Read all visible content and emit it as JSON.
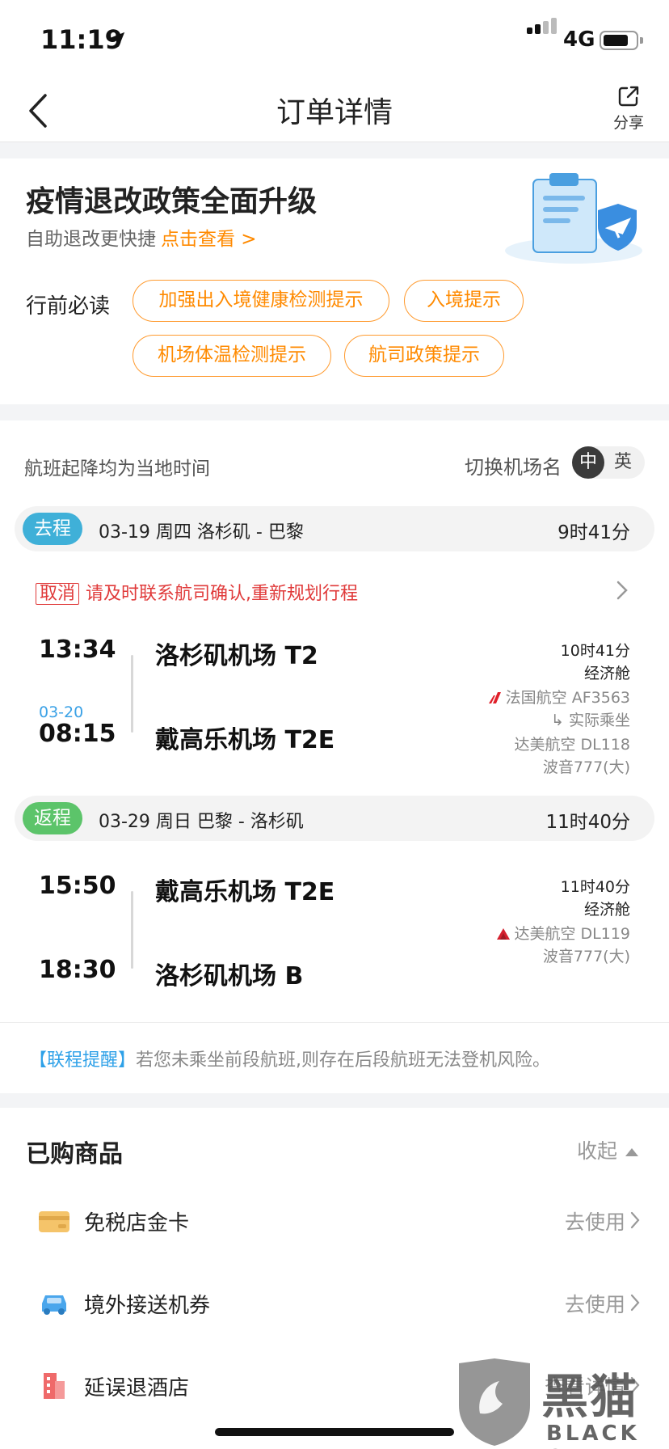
{
  "status_bar": {
    "time": "11:19",
    "network": "4G"
  },
  "nav": {
    "title": "订单详情",
    "share_label": "分享"
  },
  "policy": {
    "title": "疫情退改政策全面升级",
    "subtitle": "自助退改更快捷",
    "link": "点击查看 >",
    "must_read_label": "行前必读",
    "tags": [
      "加强出入境健康检测提示",
      "入境提示",
      "机场体温检测提示",
      "航司政策提示"
    ]
  },
  "flights": {
    "tz_note": "航班起降均为当地时间",
    "switch_label": "切换机场名",
    "lang_zh": "中",
    "lang_en": "英",
    "outbound": {
      "tag": "去程",
      "info": "03-19  周四  洛杉矶 - 巴黎",
      "duration": "9时41分",
      "cancel_tag": "取消",
      "cancel_text": "请及时联系航司确认,重新规划行程",
      "dep_time": "13:34",
      "dep_airport": "洛杉矶机场 T2",
      "arr_date": "03-20",
      "arr_time": "08:15",
      "arr_airport": "戴高乐机场 T2E",
      "flight_duration": "10时41分",
      "cabin": "经济舱",
      "airline": "法国航空 AF3563",
      "actual_label": "↳ 实际乘坐",
      "operating": "达美航空 DL118",
      "aircraft": "波音777(大)"
    },
    "return": {
      "tag": "返程",
      "info": "03-29  周日  巴黎 - 洛杉矶",
      "duration": "11时40分",
      "dep_time": "15:50",
      "dep_airport": "戴高乐机场 T2E",
      "arr_time": "18:30",
      "arr_airport": "洛杉矶机场 B",
      "flight_duration": "11时40分",
      "cabin": "经济舱",
      "airline": "达美航空 DL119",
      "aircraft": "波音777(大)"
    },
    "reminder_tag": "【联程提醒】",
    "reminder_text": "若您未乘坐前段航班,则存在后段航班无法登机风险。"
  },
  "goods": {
    "title": "已购商品",
    "fold_label": "收起",
    "items": [
      {
        "name": "免税店金卡",
        "action": "去使用"
      },
      {
        "name": "境外接送机券",
        "action": "去使用"
      },
      {
        "name": "延误退酒店",
        "action": "查看详情"
      }
    ]
  },
  "watermark": {
    "cn": "黑猫",
    "en": "BLACK CAT"
  },
  "colors": {
    "accent_orange": "#ff8a00",
    "outbound_tag": "#3fb0d8",
    "return_tag": "#5cc46a",
    "cancel_red": "#e03a3a",
    "link_blue": "#2ea1e8"
  }
}
